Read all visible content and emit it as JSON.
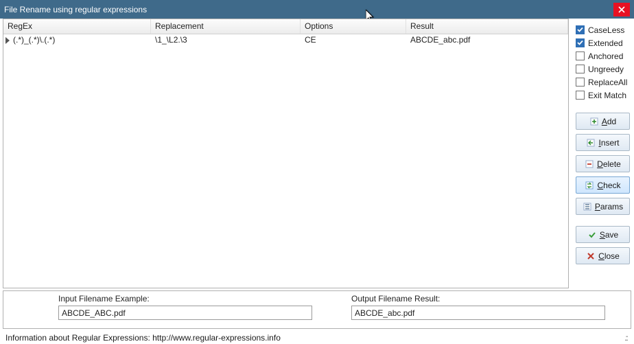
{
  "title": "File Rename using regular expressions",
  "columns": {
    "regex": "RegEx",
    "repl": "Replacement",
    "opt": "Options",
    "res": "Result"
  },
  "row": {
    "regex": "(.*)_(.*)\\.(.*)",
    "repl": "\\1_\\L2.\\3",
    "opt": "CE",
    "res": "ABCDE_abc.pdf"
  },
  "options": {
    "caseless": {
      "label": "CaseLess",
      "checked": true
    },
    "extended": {
      "label": "Extended",
      "checked": true
    },
    "anchored": {
      "label": "Anchored",
      "checked": false
    },
    "ungreedy": {
      "label": "Ungreedy",
      "checked": false
    },
    "replaceall": {
      "label": "ReplaceAll",
      "checked": false
    },
    "exitmatch": {
      "label": "Exit Match",
      "checked": false
    }
  },
  "buttons": {
    "add": {
      "label": "Add",
      "ul": "A"
    },
    "insert": {
      "label": "Insert",
      "ul": "I"
    },
    "delete": {
      "label": "Delete",
      "ul": "D"
    },
    "check": {
      "label": "Check",
      "ul": "C"
    },
    "params": {
      "label": "Params",
      "ul": "P"
    },
    "save": {
      "label": "Save",
      "ul": "S"
    },
    "close": {
      "label": "Close",
      "ul": "C"
    }
  },
  "bottom": {
    "in_label": "Input Filename Example:",
    "in_value": "ABCDE_ABC.pdf",
    "out_label": "Output Filename Result:",
    "out_value": "ABCDE_abc.pdf"
  },
  "status": "Information about Regular Expressions: http://www.regular-expressions.info",
  "grip": ".::"
}
